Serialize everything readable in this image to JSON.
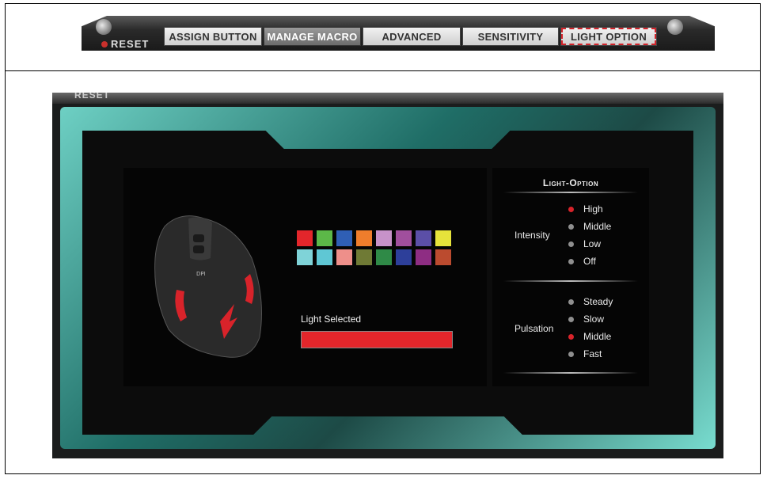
{
  "tabs": [
    {
      "label": "ASSIGN BUTTON",
      "active": false
    },
    {
      "label": "MANAGE MACRO",
      "active": true
    },
    {
      "label": "ADVANCED",
      "active": false
    },
    {
      "label": "SENSITIVITY",
      "active": false
    },
    {
      "label": "LIGHT OPTION",
      "active": false,
      "highlighted": true
    }
  ],
  "reset_label": "RESET",
  "panel_reset_label": "RESET",
  "colors": {
    "accent_red": "#d8232a",
    "teal": "#3aa89b"
  },
  "swatches": [
    "#e3262b",
    "#5cb848",
    "#2f5fb5",
    "#ef7d2c",
    "#c792c9",
    "#a04f9d",
    "#5b4fa7",
    "#e6e33b",
    "#7fd3d8",
    "#5fc7d4",
    "#ee8f8a",
    "#6f7a35",
    "#2f8a47",
    "#2d3f9a",
    "#8e2d83",
    "#bb4b2f"
  ],
  "light_selected": {
    "label": "Light Selected",
    "color": "#e3262b"
  },
  "light_option": {
    "title": "Light-Option",
    "intensity": {
      "label": "Intensity",
      "options": [
        {
          "label": "High",
          "selected": true
        },
        {
          "label": "Middle",
          "selected": false
        },
        {
          "label": "Low",
          "selected": false
        },
        {
          "label": "Off",
          "selected": false
        }
      ]
    },
    "pulsation": {
      "label": "Pulsation",
      "options": [
        {
          "label": "Steady",
          "selected": false
        },
        {
          "label": "Slow",
          "selected": false
        },
        {
          "label": "Middle",
          "selected": true
        },
        {
          "label": "Fast",
          "selected": false
        }
      ]
    }
  },
  "mouse_labels": {
    "dpi": "DPI"
  }
}
